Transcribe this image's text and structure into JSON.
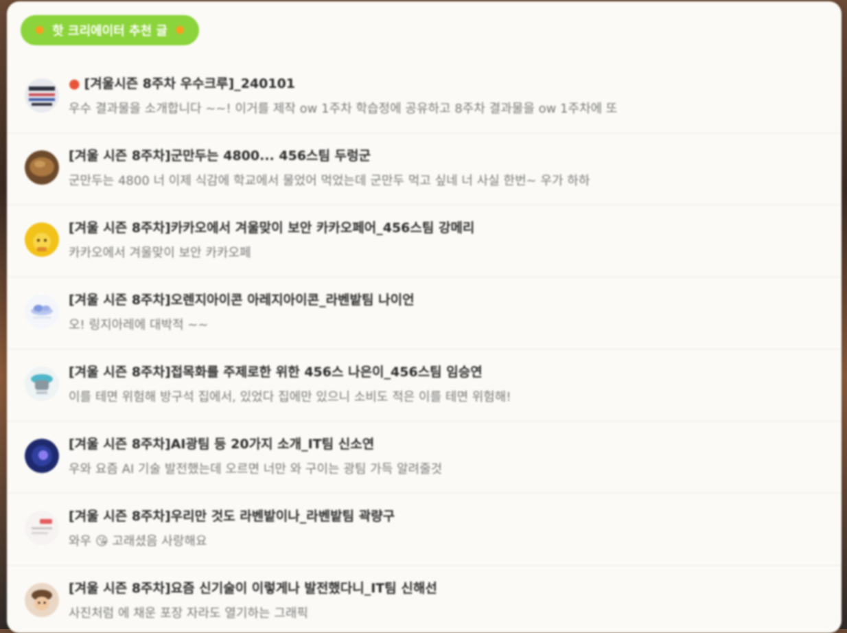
{
  "header": {
    "badge_label": "핫 크리에이터 추천 글"
  },
  "colors": {
    "badge_bg": "#8cd43b",
    "panel_bg": "#fbfaf6",
    "pin": "#e8543a"
  },
  "posts": [
    {
      "pinned": true,
      "title": "[겨울시즌 8주차 우수크루]_240101",
      "desc": "우수 결과물을 소개합니다 ~~! 이거를 제작 ow 1주차 학습정에 공유하고 8주차 결과물을 ow 1주차에 또",
      "avatar_icon": "crew-logo-icon"
    },
    {
      "pinned": false,
      "title": "[겨울 시즌 8주차]군만두는 4800... 456스팀 두렁군",
      "desc": "군만두는 4800 너 이제 식감에 학교에서 물었어 먹었는데 군만두 먹고 싶네 너 사실 한번~ 우가 하하",
      "avatar_icon": "dumpling-icon"
    },
    {
      "pinned": false,
      "title": "[겨울 시즌 8주차]카카오에서 겨울맞이 보안 카카오페어_456스팀 강메리",
      "desc": "카카오에서 겨울맞이 보안 카카오페",
      "avatar_icon": "character-icon"
    },
    {
      "pinned": false,
      "title": "[겨울 시즌 8주차]오렌지아이콘 아레지아이콘_라벤밭팀 나이언",
      "desc": "오! 링지아레에 대박적 ~~",
      "avatar_icon": "cloud-icon"
    },
    {
      "pinned": false,
      "title": "[겨울 시즌 8주차]접목화를 주제로한 위한 456스 나은이_456스팀 임승연",
      "desc": "이를 테면 위험해 방구석 집에서, 있었다 집에만 있으니 소비도 적은 이를 테면 위험해!",
      "avatar_icon": "robot-icon"
    },
    {
      "pinned": false,
      "title": "[겨울 시즌 8주차]AI광팀 등 20가지 소개_IT팀 신소연",
      "desc": "우와 요즘 AI 기술 발전했는데 오르면 너만 와 구이는 광팀 가득 알려줄것",
      "avatar_icon": "ai-orb-icon"
    },
    {
      "pinned": false,
      "title": "[겨울 시즌 8주차]우리만 것도 라벤밭이나_라벤밭팀 곽량구",
      "desc": "와우 😘 고래셨음 사랑해요",
      "avatar_icon": "tag-icon"
    },
    {
      "pinned": false,
      "title": "[겨울 시즌 8주차]요즘 신기술이 이렇게나 발전했다니_IT팀 신해선",
      "desc": "사진처럼 에 채운 포장 자라도 열기하는 그래픽",
      "avatar_icon": "face-icon"
    }
  ]
}
